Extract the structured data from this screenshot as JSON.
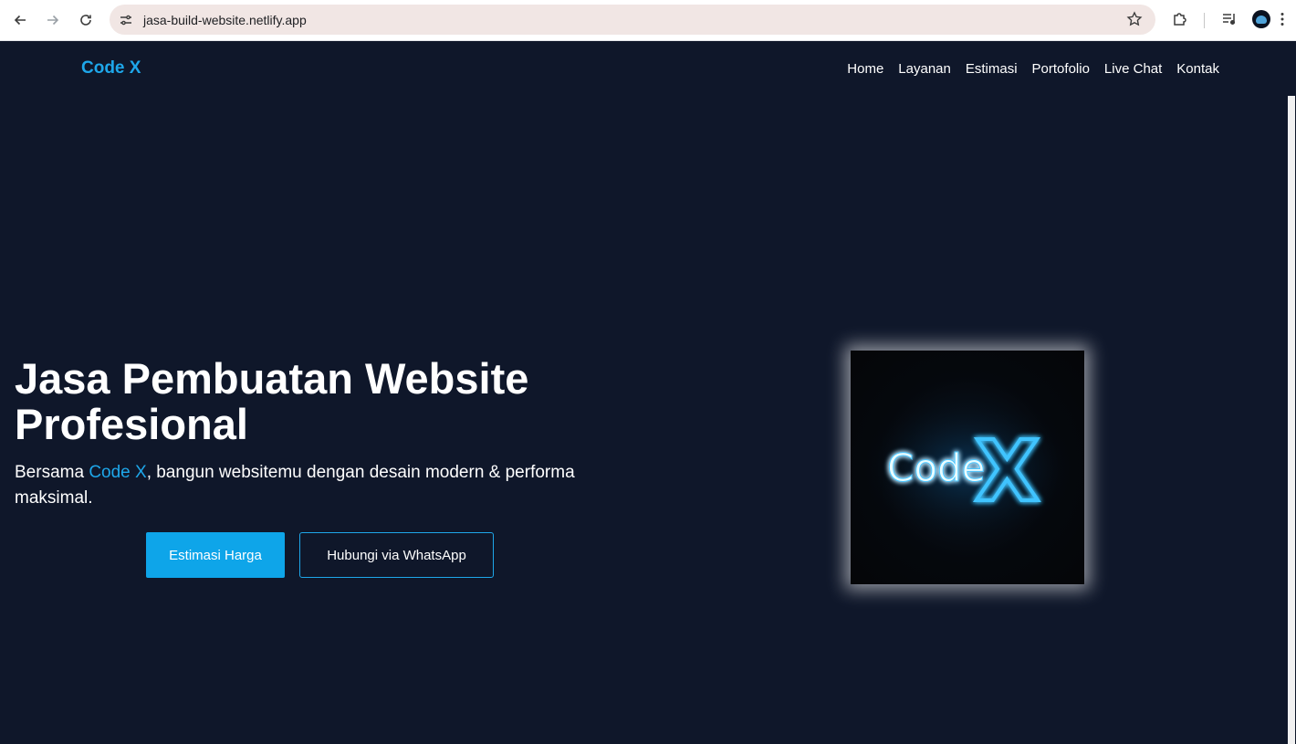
{
  "browser": {
    "url": "jasa-build-website.netlify.app",
    "icons": [
      "back-arrow-icon",
      "forward-arrow-icon",
      "reload-icon",
      "site-info-icon",
      "star-icon",
      "extensions-icon",
      "media-control-icon",
      "profile-avatar",
      "more-menu-icon"
    ]
  },
  "nav": {
    "brand": "Code X",
    "items": [
      {
        "label": "Home"
      },
      {
        "label": "Layanan"
      },
      {
        "label": "Estimasi"
      },
      {
        "label": "Portofolio"
      },
      {
        "label": "Live Chat"
      },
      {
        "label": "Kontak"
      }
    ]
  },
  "hero": {
    "title": "Jasa Pembuatan Website Profesional",
    "subtitle_before": "Bersama ",
    "subtitle_accent": "Code X",
    "subtitle_after": ", bangun websitemu dengan desain modern & performa maksimal.",
    "primary_button": "Estimasi Harga",
    "secondary_button": "Hubungi via WhatsApp"
  },
  "logo": {
    "text": "Code",
    "mark": "X"
  },
  "colors": {
    "background": "#0f172a",
    "accent": "#1ea7ea",
    "button": "#0ea5e9"
  }
}
